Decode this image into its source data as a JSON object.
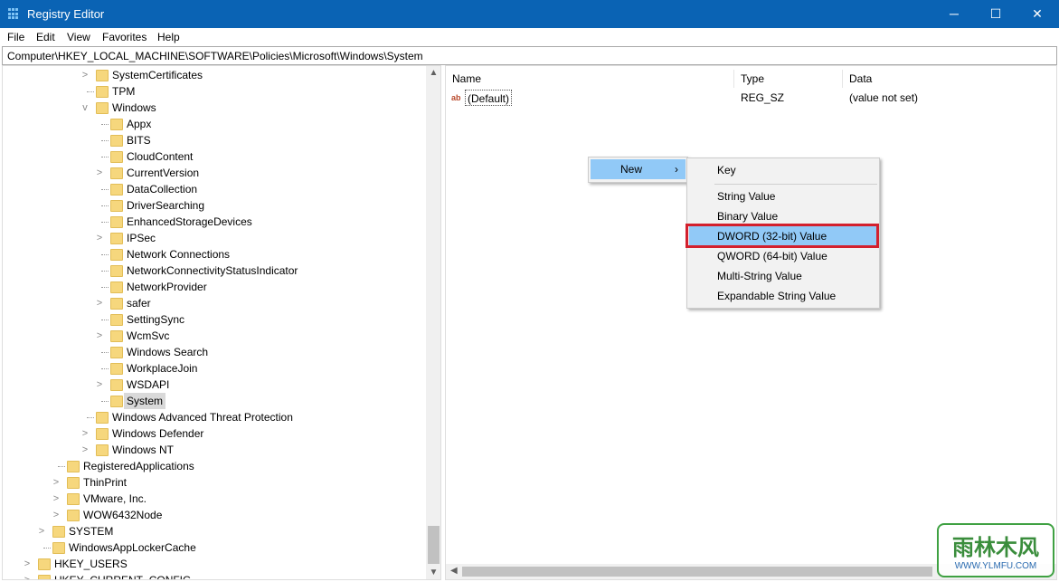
{
  "window": {
    "title": "Registry Editor",
    "minimize": "─",
    "maximize": "☐",
    "close": "✕"
  },
  "menu": [
    "File",
    "Edit",
    "View",
    "Favorites",
    "Help"
  ],
  "address": "Computer\\HKEY_LOCAL_MACHINE\\SOFTWARE\\Policies\\Microsoft\\Windows\\System",
  "tree": [
    {
      "label": "SystemCertificates",
      "depth": 4,
      "exp": "collapsed"
    },
    {
      "label": "TPM",
      "depth": 4,
      "exp": "none"
    },
    {
      "label": "Windows",
      "depth": 4,
      "exp": "expanded"
    },
    {
      "label": "Appx",
      "depth": 5,
      "exp": "none"
    },
    {
      "label": "BITS",
      "depth": 5,
      "exp": "none"
    },
    {
      "label": "CloudContent",
      "depth": 5,
      "exp": "none"
    },
    {
      "label": "CurrentVersion",
      "depth": 5,
      "exp": "collapsed"
    },
    {
      "label": "DataCollection",
      "depth": 5,
      "exp": "none"
    },
    {
      "label": "DriverSearching",
      "depth": 5,
      "exp": "none"
    },
    {
      "label": "EnhancedStorageDevices",
      "depth": 5,
      "exp": "none"
    },
    {
      "label": "IPSec",
      "depth": 5,
      "exp": "collapsed"
    },
    {
      "label": "Network Connections",
      "depth": 5,
      "exp": "none"
    },
    {
      "label": "NetworkConnectivityStatusIndicator",
      "depth": 5,
      "exp": "none"
    },
    {
      "label": "NetworkProvider",
      "depth": 5,
      "exp": "none"
    },
    {
      "label": "safer",
      "depth": 5,
      "exp": "collapsed"
    },
    {
      "label": "SettingSync",
      "depth": 5,
      "exp": "none"
    },
    {
      "label": "WcmSvc",
      "depth": 5,
      "exp": "collapsed"
    },
    {
      "label": "Windows Search",
      "depth": 5,
      "exp": "none"
    },
    {
      "label": "WorkplaceJoin",
      "depth": 5,
      "exp": "none"
    },
    {
      "label": "WSDAPI",
      "depth": 5,
      "exp": "collapsed"
    },
    {
      "label": "System",
      "depth": 5,
      "exp": "none",
      "selected": true
    },
    {
      "label": "Windows Advanced Threat Protection",
      "depth": 4,
      "exp": "none"
    },
    {
      "label": "Windows Defender",
      "depth": 4,
      "exp": "collapsed"
    },
    {
      "label": "Windows NT",
      "depth": 4,
      "exp": "collapsed"
    },
    {
      "label": "RegisteredApplications",
      "depth": 2,
      "exp": "none"
    },
    {
      "label": "ThinPrint",
      "depth": 2,
      "exp": "collapsed"
    },
    {
      "label": "VMware, Inc.",
      "depth": 2,
      "exp": "collapsed"
    },
    {
      "label": "WOW6432Node",
      "depth": 2,
      "exp": "collapsed"
    },
    {
      "label": "SYSTEM",
      "depth": 1,
      "exp": "collapsed"
    },
    {
      "label": "WindowsAppLockerCache",
      "depth": 1,
      "exp": "none"
    },
    {
      "label": "HKEY_USERS",
      "depth": 0,
      "exp": "collapsed"
    },
    {
      "label": "HKEY_CURRENT_CONFIG",
      "depth": 0,
      "exp": "collapsed"
    }
  ],
  "columns": {
    "name": "Name",
    "type": "Type",
    "data": "Data"
  },
  "values": [
    {
      "icon": "ab",
      "name": "(Default)",
      "type": "REG_SZ",
      "data": "(value not set)"
    }
  ],
  "context_menu": {
    "new": "New",
    "arrow": "›"
  },
  "submenu": [
    {
      "label": "Key"
    },
    {
      "label": "String Value"
    },
    {
      "label": "Binary Value"
    },
    {
      "label": "DWORD (32-bit) Value",
      "highlighted": true
    },
    {
      "label": "QWORD (64-bit) Value"
    },
    {
      "label": "Multi-String Value"
    },
    {
      "label": "Expandable String Value"
    }
  ],
  "colors": {
    "titlebar": "#0a63b4",
    "highlight": "#91c9f7",
    "annotation": "#d3202d"
  },
  "watermark": {
    "main": "雨林木风",
    "url": "WWW.YLMFU.COM"
  }
}
